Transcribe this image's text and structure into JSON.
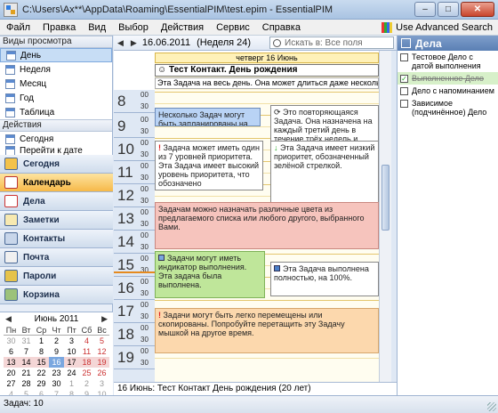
{
  "window": {
    "title": "C:\\Users\\Ax**\\AppData\\Roaming\\EssentialPIM\\test.epim - EssentialPIM",
    "btn_min": "–",
    "btn_max": "□",
    "btn_close": "✕"
  },
  "menu": {
    "items": [
      "Файл",
      "Правка",
      "Вид",
      "Выбор",
      "Действия",
      "Сервис",
      "Справка"
    ],
    "advanced_search": "Use Advanced Search"
  },
  "sidebar": {
    "views_header": "Виды просмотра",
    "views": [
      {
        "label": "День",
        "icon": "day-icon"
      },
      {
        "label": "Неделя",
        "icon": "week-icon"
      },
      {
        "label": "Месяц",
        "icon": "month-icon"
      },
      {
        "label": "Год",
        "icon": "year-icon"
      },
      {
        "label": "Таблица",
        "icon": "table-icon"
      }
    ],
    "actions_header": "Действия",
    "actions": [
      {
        "label": "Сегодня",
        "icon": "today-icon"
      },
      {
        "label": "Перейти к дате",
        "icon": "goto-date-icon"
      }
    ],
    "modules": [
      {
        "label": "Сегодня",
        "icon": "today-icon"
      },
      {
        "label": "Календарь",
        "icon": "calendar-icon"
      },
      {
        "label": "Дела",
        "icon": "tasks-icon"
      },
      {
        "label": "Заметки",
        "icon": "notes-icon"
      },
      {
        "label": "Контакты",
        "icon": "contacts-icon"
      },
      {
        "label": "Почта",
        "icon": "mail-icon"
      },
      {
        "label": "Пароли",
        "icon": "passwords-icon"
      },
      {
        "label": "Корзина",
        "icon": "trash-icon"
      }
    ]
  },
  "minical": {
    "month": "Июнь",
    "year": "2011",
    "dows": [
      "Пн",
      "Вт",
      "Ср",
      "Чт",
      "Пт",
      "Сб",
      "Вс"
    ],
    "weeks": [
      [
        "30",
        "31",
        "1",
        "2",
        "3",
        "4",
        "5"
      ],
      [
        "6",
        "7",
        "8",
        "9",
        "10",
        "11",
        "12"
      ],
      [
        "13",
        "14",
        "15",
        "16",
        "17",
        "18",
        "19"
      ],
      [
        "20",
        "21",
        "22",
        "23",
        "24",
        "25",
        "26"
      ],
      [
        "27",
        "28",
        "29",
        "30",
        "1",
        "2",
        "3"
      ],
      [
        "4",
        "5",
        "6",
        "7",
        "8",
        "9",
        "10"
      ]
    ],
    "selected_day": "16"
  },
  "toolbar": {
    "date": "16.06.2011",
    "week": "(Неделя 24)",
    "search_placeholder": "Искать в: Все поля"
  },
  "day": {
    "header": "четверг 16 Июнь",
    "allday": [
      "Тест Контакт. День рождения",
      "Эта Задача на весь день. Она может длиться даже несколько дней"
    ],
    "hours": [
      "8",
      "9",
      "10",
      "11",
      "12",
      "13",
      "14",
      "15",
      "16",
      "17",
      "18",
      "19"
    ],
    "min00": "00",
    "min30": "30",
    "events": {
      "e1": "Несколько Задач могут быть запланированы на одно время.",
      "e2": "Это повторяющаяся Задача. Она назначена на каждый третий день в течение трёх недель и будет повторяться",
      "e3": "Задача может иметь один из 7 уровней приоритета. Эта Задача имеет высокий уровень приоритета, что обозначено",
      "e4": "Эта Задача имеет низкий приоритет, обозначенный зелёной стрелкой.",
      "e5": "Задачам можно назначать различные цвета из предлагаемого списка или любого другого, выбранного Вами.",
      "e6": "Задачи могут иметь индикатор выполнения. Эта задача была выполнена.",
      "e7": "Эта Задача выполнена полностью, на 100%.",
      "e8": "Задачи могут быть легко перемещены или скопированы. Попробуйте перетащить эту Задачу мышкой на другое время."
    }
  },
  "day_status": "16 Июнь:  Тест Контакт День рождения  (20 лет)",
  "tasks": {
    "title": "Дела",
    "items": [
      {
        "label": "Тестовое Дело с датой выполнения",
        "done": false
      },
      {
        "label": "Выполненное Дело",
        "done": true
      },
      {
        "label": "Дело с напоминанием",
        "done": false
      },
      {
        "label": "Зависимое (подчинённое) Дело",
        "done": false
      }
    ]
  },
  "statusbar": {
    "text": "Задач: 10"
  },
  "colors": {
    "event_blue": "#b9d3f5",
    "event_red": "#f6c4bd",
    "event_green": "#bfe69a",
    "event_orange": "#fcd8ad",
    "highlight": "#f6b949"
  }
}
